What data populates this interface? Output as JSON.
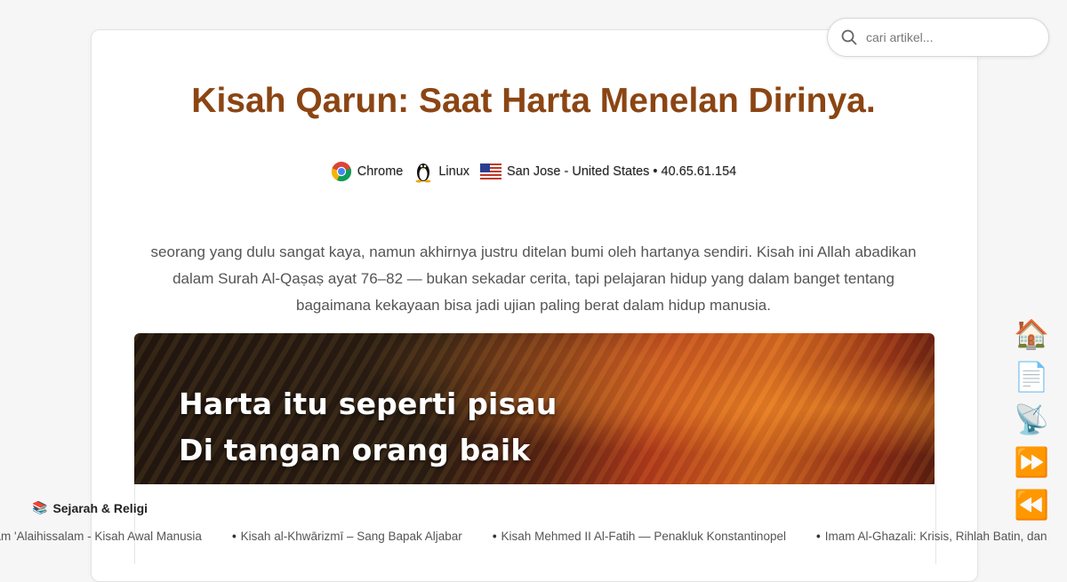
{
  "article": {
    "title": "Kisah Qarun: Saat Harta Menelan Dirinya.",
    "lead": "seorang yang dulu sangat kaya, namun akhirnya justru ditelan bumi oleh hartanya sendiri. Kisah ini Allah abadikan dalam Surah Al-Qaṣaṣ ayat 76–82 — bukan sekadar cerita, tapi pelajaran hidup yang dalam banget tentang bagaimana kekayaan bisa jadi ujian paling berat dalam hidup manusia."
  },
  "visitor": {
    "browser": "Chrome",
    "os": "Linux",
    "location": "San Jose - United States • 40.65.61.154",
    "icons": {
      "browser": "chrome-icon",
      "os": "linux-icon",
      "flag": "us-flag-icon"
    }
  },
  "hero": {
    "line1": "Harta itu seperti pisau",
    "line2": "Di tangan orang baik"
  },
  "search": {
    "placeholder": "cari artikel..."
  },
  "sidenav": {
    "items": [
      {
        "name": "home",
        "glyph": "🏠"
      },
      {
        "name": "page",
        "glyph": "📄"
      },
      {
        "name": "rss",
        "glyph": "📡"
      },
      {
        "name": "next",
        "glyph": "⏩"
      },
      {
        "name": "prev",
        "glyph": "⏪"
      }
    ]
  },
  "ticker": {
    "label_icon": "📚",
    "label": "Sejarah & Religi",
    "items": [
      "dam 'Alaihissalam - Kisah Awal Manusia",
      "Kisah al-Khwārizmī – Sang Bapak Aljabar",
      "Kisah Mehmed II Al-Fatih — Penakluk Konstantinopel",
      "Imam Al-Ghazali: Krisis, Rihlah Batin, dan"
    ]
  },
  "colors": {
    "title": "#8b4513",
    "background": "#f6f6f6"
  }
}
